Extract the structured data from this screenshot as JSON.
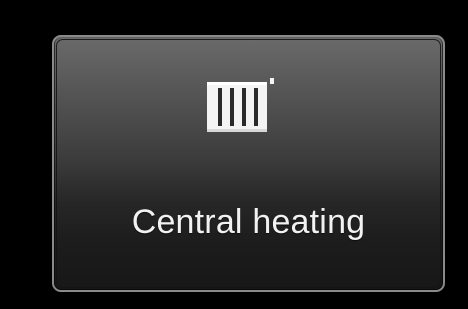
{
  "tile": {
    "label": "Central heating",
    "icon": "radiator-icon"
  },
  "colors": {
    "background": "#000000",
    "tile_top": "#6a6a6a",
    "tile_bottom": "#171717",
    "border": "#8a8a8a",
    "text": "#f2f2f2"
  }
}
